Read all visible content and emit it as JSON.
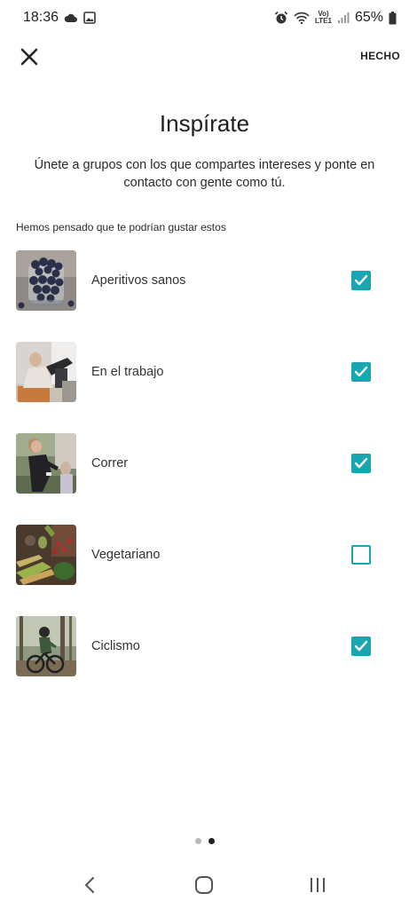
{
  "status_bar": {
    "time": "18:36",
    "network_top": "Vo)",
    "network_bottom": "LTE1",
    "battery": "65%",
    "icons": [
      "cloud-icon",
      "image-icon",
      "alarm-icon",
      "wifi-icon",
      "signal-icon",
      "battery-icon"
    ]
  },
  "header": {
    "close_icon": "close-icon",
    "done_label": "HECHO"
  },
  "title": "Inspírate",
  "subtitle": "Únete a grupos con los que compartes intereses y ponte en contacto con gente como tú.",
  "section_label": "Hemos pensado que te podrían gustar estos",
  "groups": [
    {
      "label": "Aperitivos sanos",
      "checked": true,
      "image": "blueberries-jar-photo"
    },
    {
      "label": "En el trabajo",
      "checked": true,
      "image": "office-stretch-photo"
    },
    {
      "label": "Correr",
      "checked": true,
      "image": "runner-photo"
    },
    {
      "label": "Vegetariano",
      "checked": false,
      "image": "vegetables-photo"
    },
    {
      "label": "Ciclismo",
      "checked": true,
      "image": "cyclist-photo"
    }
  ],
  "pager": {
    "pages": 2,
    "current": 2
  },
  "colors": {
    "accent": "#1aa6b0",
    "text": "#2b2b2b",
    "background": "#ffffff"
  }
}
